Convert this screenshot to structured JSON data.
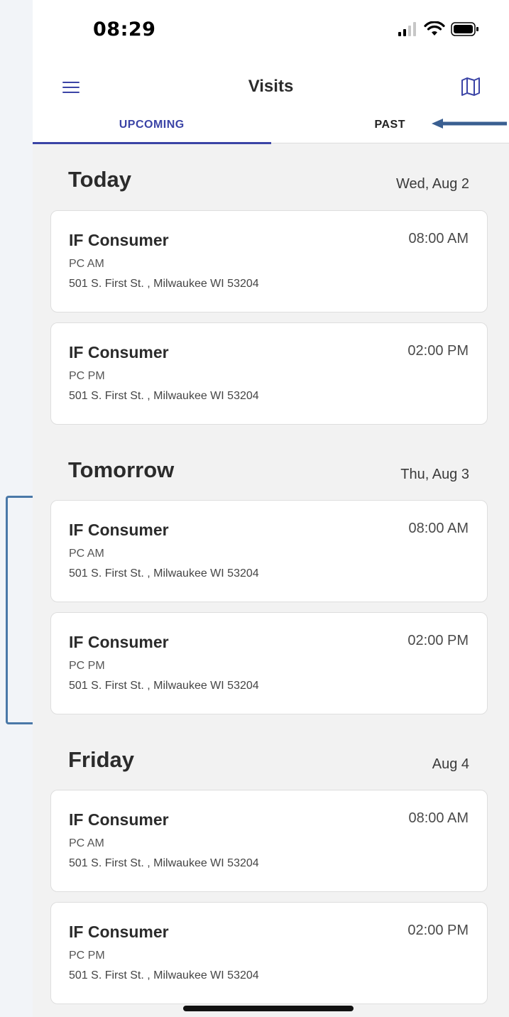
{
  "status_bar": {
    "time": "08:29",
    "icons": [
      "signal-icon",
      "wifi-icon",
      "battery-icon"
    ]
  },
  "header": {
    "title": "Visits",
    "menu_icon": "menu-icon",
    "map_icon": "map-icon"
  },
  "tabs": [
    {
      "label": "UPCOMING",
      "active": true
    },
    {
      "label": "PAST",
      "active": false
    }
  ],
  "sections": [
    {
      "title": "Today",
      "date": "Wed, Aug 2",
      "visits": [
        {
          "name": "IF Consumer",
          "time": "08:00 AM",
          "service": "PC AM",
          "address": "501 S. First St. , Milwaukee WI 53204"
        },
        {
          "name": "IF Consumer",
          "time": "02:00 PM",
          "service": "PC PM",
          "address": "501 S. First St. , Milwaukee WI 53204"
        }
      ]
    },
    {
      "title": "Tomorrow",
      "date": "Thu, Aug 3",
      "visits": [
        {
          "name": "IF Consumer",
          "time": "08:00 AM",
          "service": "PC AM",
          "address": "501 S. First St. , Milwaukee WI 53204"
        },
        {
          "name": "IF Consumer",
          "time": "02:00 PM",
          "service": "PC PM",
          "address": "501 S. First St. , Milwaukee WI 53204"
        }
      ]
    },
    {
      "title": "Friday",
      "date": "Aug 4",
      "visits": [
        {
          "name": "IF Consumer",
          "time": "08:00 AM",
          "service": "PC AM",
          "address": "501 S. First St. , Milwaukee WI 53204"
        },
        {
          "name": "IF Consumer",
          "time": "02:00 PM",
          "service": "PC PM",
          "address": "501 S. First St. , Milwaukee WI 53204"
        }
      ]
    }
  ],
  "colors": {
    "accent": "#3b44a6",
    "background": "#f2f2f2",
    "card": "#ffffff",
    "annotation": "#4a78a8"
  }
}
